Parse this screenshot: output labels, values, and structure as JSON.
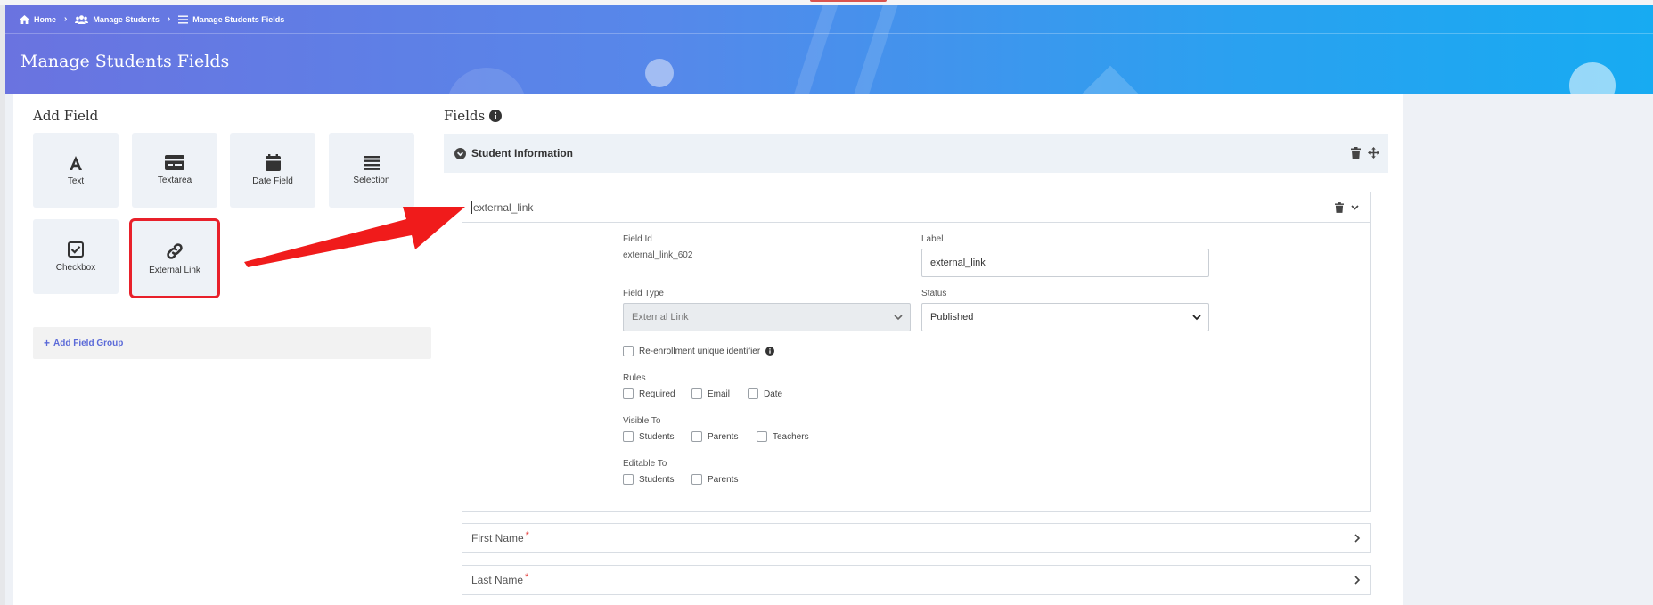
{
  "breadcrumb": {
    "items": [
      {
        "label": "Home",
        "icon": "home-icon"
      },
      {
        "label": "Manage Students",
        "icon": "users-icon"
      },
      {
        "label": "Manage Students Fields",
        "icon": "list-icon"
      }
    ]
  },
  "page": {
    "title": "Manage Students Fields"
  },
  "add_field": {
    "title": "Add Field",
    "tiles": [
      {
        "label": "Text",
        "icon": "text-icon"
      },
      {
        "label": "Textarea",
        "icon": "textarea-icon"
      },
      {
        "label": "Date Field",
        "icon": "calendar-icon"
      },
      {
        "label": "Selection",
        "icon": "list-icon"
      },
      {
        "label": "Checkbox",
        "icon": "checkbox-icon"
      },
      {
        "label": "External Link",
        "icon": "link-icon"
      }
    ],
    "add_group_label": "Add Field Group"
  },
  "fields": {
    "title": "Fields",
    "group": {
      "name": "Student Information"
    },
    "active_field": {
      "header_value": "external_link",
      "field_id_label": "Field Id",
      "field_id_value": "external_link_602",
      "label_label": "Label",
      "label_value": "external_link",
      "field_type_label": "Field Type",
      "field_type_value": "External Link",
      "status_label": "Status",
      "status_value": "Published",
      "reenroll_label": "Re-enrollment unique identifier",
      "rules_label": "Rules",
      "rules": [
        "Required",
        "Email",
        "Date"
      ],
      "visible_label": "Visible To",
      "visible": [
        "Students",
        "Parents",
        "Teachers"
      ],
      "editable_label": "Editable To",
      "editable": [
        "Students",
        "Parents"
      ]
    },
    "collapsed_fields": [
      {
        "label": "First Name",
        "required": "*"
      },
      {
        "label": "Last Name",
        "required": "*"
      }
    ]
  },
  "colors": {
    "accent": "#5b6ad8",
    "highlight": "#e8202a",
    "header_start": "#6a73e0",
    "header_end": "#17abf2"
  }
}
